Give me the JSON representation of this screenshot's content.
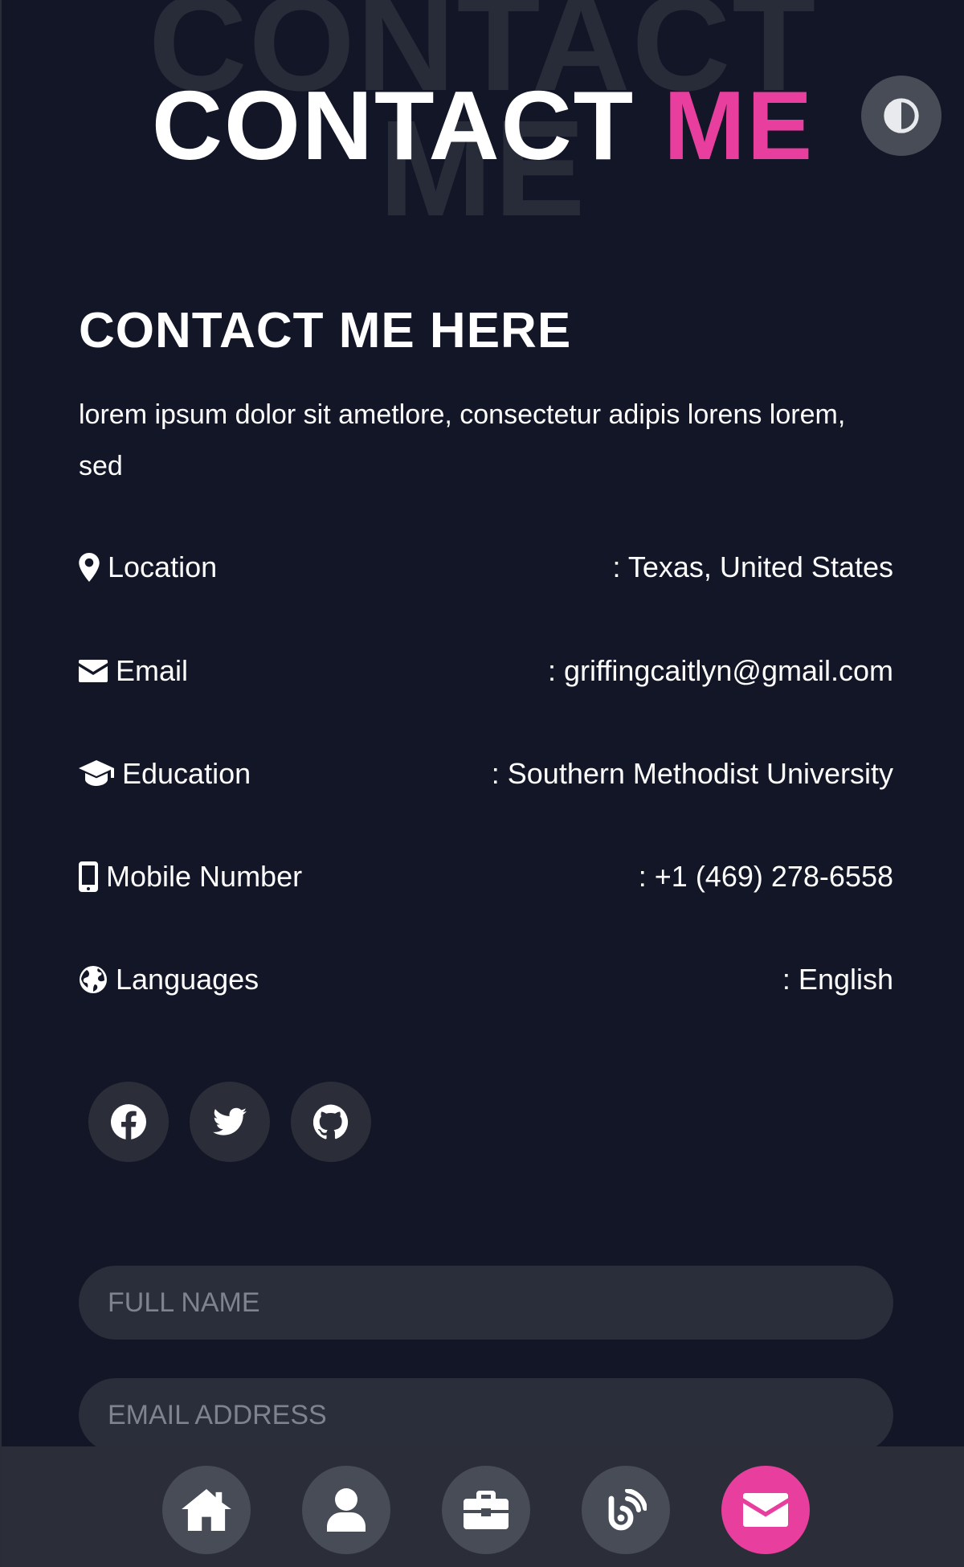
{
  "header": {
    "bg_line1": "CONTACT",
    "bg_line2": "ME",
    "title_word1": "CONTACT",
    "title_word2": "ME",
    "theme_toggle_icon": "half-circle-contrast-icon"
  },
  "contact": {
    "heading": "CONTACT ME HERE",
    "description": "lorem ipsum dolor sit ametlore, consectetur adipis lorens lorem, sed",
    "items": [
      {
        "icon": "map-marker-icon",
        "label": "Location",
        "value": ": Texas, United States"
      },
      {
        "icon": "envelope-icon",
        "label": "Email",
        "value": ": griffingcaitlyn@gmail.com"
      },
      {
        "icon": "graduation-cap-icon",
        "label": "Education",
        "value": ": Southern Methodist University"
      },
      {
        "icon": "mobile-phone-icon",
        "label": "Mobile Number",
        "value": ": +1 (469) 278-6558"
      },
      {
        "icon": "globe-icon",
        "label": "Languages",
        "value": ": English"
      }
    ]
  },
  "socials": [
    {
      "icon": "facebook-icon"
    },
    {
      "icon": "twitter-icon"
    },
    {
      "icon": "github-icon"
    }
  ],
  "form": {
    "full_name_placeholder": "FULL NAME",
    "email_placeholder": "EMAIL ADDRESS"
  },
  "bottom_nav": [
    {
      "icon": "home-icon",
      "active": false
    },
    {
      "icon": "user-icon",
      "active": false
    },
    {
      "icon": "briefcase-icon",
      "active": false
    },
    {
      "icon": "blog-icon",
      "active": false
    },
    {
      "icon": "envelope-icon",
      "active": true
    }
  ],
  "colors": {
    "background": "#121627",
    "accent": "#e83e9e",
    "button_bg": "#474c57",
    "field_bg": "#2a2e3a"
  }
}
